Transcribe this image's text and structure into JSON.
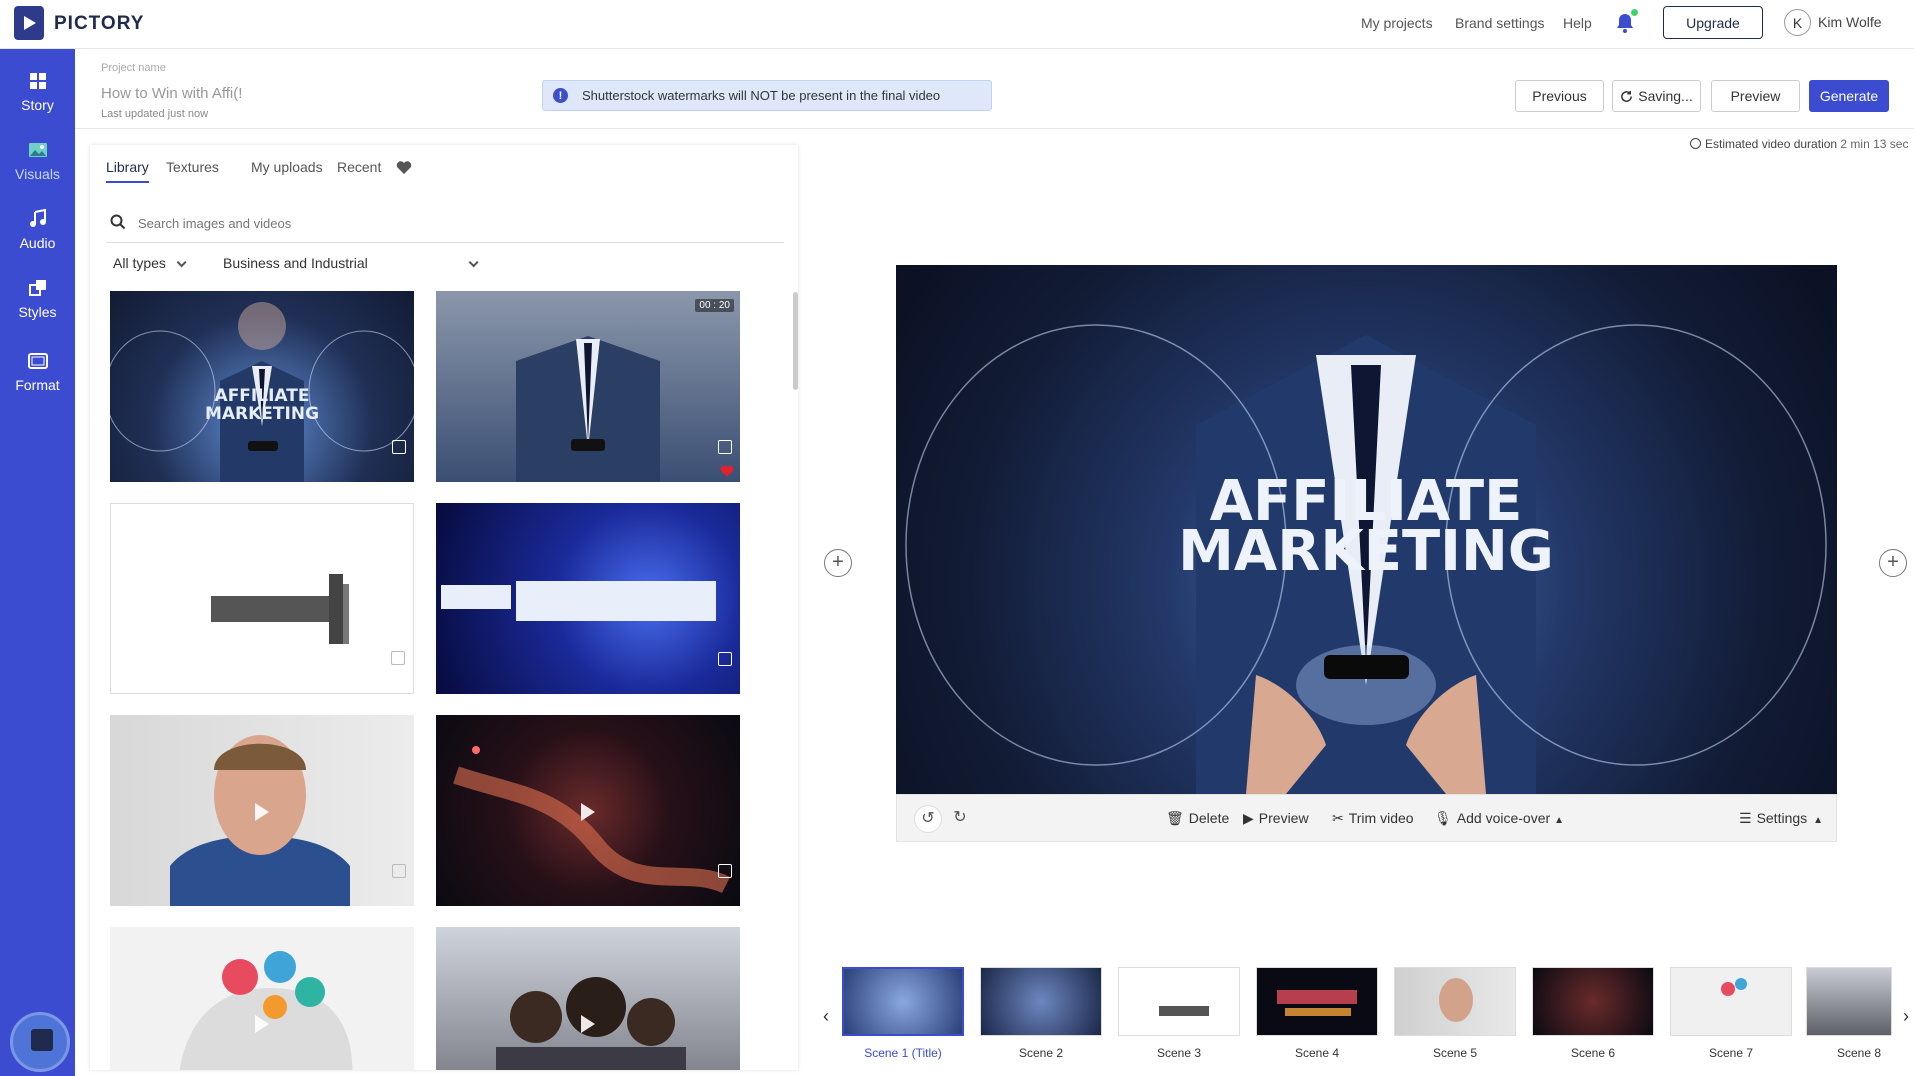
{
  "header": {
    "brand": "PICTORY",
    "nav": [
      "My projects",
      "Brand settings",
      "Help"
    ],
    "upgrade_label": "Upgrade",
    "avatar_initial": "K",
    "user_name": "Kim Wolfe"
  },
  "sidebar": {
    "items": [
      {
        "label": "Story",
        "icon": "grid-icon"
      },
      {
        "label": "Visuals",
        "icon": "image-icon"
      },
      {
        "label": "Audio",
        "icon": "music-icon"
      },
      {
        "label": "Styles",
        "icon": "styles-icon"
      },
      {
        "label": "Format",
        "icon": "format-icon"
      }
    ],
    "active": "Visuals"
  },
  "project": {
    "label": "Project name",
    "name": "How to Win with Affi(!",
    "updated": "Last updated just now",
    "notice": "Shutterstock watermarks will NOT be present in the final video",
    "notice_icon": "!",
    "buttons": {
      "previous": "Previous",
      "saving": "Saving...",
      "preview": "Preview",
      "generate": "Generate"
    }
  },
  "media": {
    "tabs": [
      "Library",
      "Textures",
      "My uploads",
      "Recent"
    ],
    "active_tab": "Library",
    "search_placeholder": "Search images and videos",
    "type_filter": "All types",
    "category_filter": "Business and Industrial",
    "duration_badge": "00 : 20"
  },
  "preview": {
    "estimated_label": "Estimated video duration",
    "estimated_value": "2 min 13 sec",
    "overlay_text_1": "AFFILIATE",
    "overlay_text_2": "MARKETING",
    "controls": {
      "delete": "Delete",
      "preview": "Preview",
      "trim": "Trim video",
      "voice": "Add voice-over",
      "settings": "Settings"
    }
  },
  "timeline": {
    "scenes": [
      "Scene 1 (Title)",
      "Scene 2",
      "Scene 3",
      "Scene 4",
      "Scene 5",
      "Scene 6",
      "Scene 7",
      "Scene 8"
    ],
    "active_index": 0
  },
  "colors": {
    "accent": "#3c4cd1",
    "brand_dark": "#1f2a4d",
    "notice_bg": "#dfe8fb",
    "favorite": "#e5202b"
  }
}
